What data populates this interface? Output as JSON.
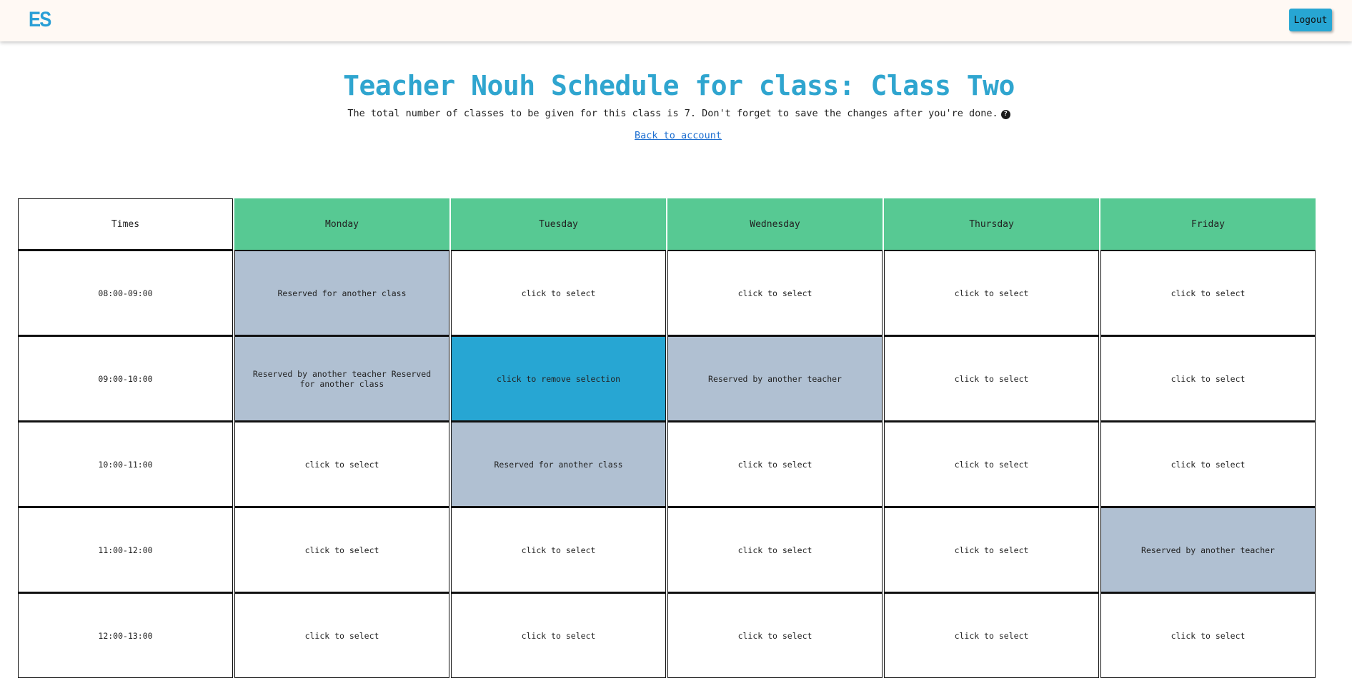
{
  "navbar": {
    "logo_text": "ES",
    "logout_label": "Logout"
  },
  "header": {
    "title": "Teacher Nouh Schedule for class: Class Two",
    "subtitle": "The total number of classes to be given for this class is 7. Don't forget to save the changes after you're done.",
    "help_icon": "question-circle-icon",
    "back_link": "Back to account"
  },
  "colors": {
    "brand": "#2a9fd6",
    "title": "#2fa5cf",
    "day_header": "#57c993",
    "reserved": "#b0c0d2",
    "selected": "#27a6d3",
    "link": "#1e6fd0",
    "navbar_bg": "#fff9f4"
  },
  "table": {
    "times_header": "Times",
    "days": [
      "Monday",
      "Tuesday",
      "Wednesday",
      "Thursday",
      "Friday"
    ],
    "rows": [
      {
        "time": "08:00-09:00",
        "cells": [
          {
            "text": "Reserved for another class",
            "state": "reserved"
          },
          {
            "text": "click to select",
            "state": "available"
          },
          {
            "text": "click to select",
            "state": "available"
          },
          {
            "text": "click to select",
            "state": "available"
          },
          {
            "text": "click to select",
            "state": "available"
          }
        ]
      },
      {
        "time": "09:00-10:00",
        "cells": [
          {
            "text": "Reserved by another teacher Reserved for another class",
            "state": "reserved"
          },
          {
            "text": "click to remove selection",
            "state": "selected"
          },
          {
            "text": "Reserved by another teacher",
            "state": "reserved"
          },
          {
            "text": "click to select",
            "state": "available"
          },
          {
            "text": "click to select",
            "state": "available"
          }
        ]
      },
      {
        "time": "10:00-11:00",
        "cells": [
          {
            "text": "click to select",
            "state": "available"
          },
          {
            "text": "Reserved for another class",
            "state": "reserved"
          },
          {
            "text": "click to select",
            "state": "available"
          },
          {
            "text": "click to select",
            "state": "available"
          },
          {
            "text": "click to select",
            "state": "available"
          }
        ]
      },
      {
        "time": "11:00-12:00",
        "cells": [
          {
            "text": "click to select",
            "state": "available"
          },
          {
            "text": "click to select",
            "state": "available"
          },
          {
            "text": "click to select",
            "state": "available"
          },
          {
            "text": "click to select",
            "state": "available"
          },
          {
            "text": "Reserved by another teacher",
            "state": "reserved"
          }
        ]
      },
      {
        "time": "12:00-13:00",
        "cells": [
          {
            "text": "click to select",
            "state": "available"
          },
          {
            "text": "click to select",
            "state": "available"
          },
          {
            "text": "click to select",
            "state": "available"
          },
          {
            "text": "click to select",
            "state": "available"
          },
          {
            "text": "click to select",
            "state": "available"
          }
        ]
      }
    ]
  }
}
